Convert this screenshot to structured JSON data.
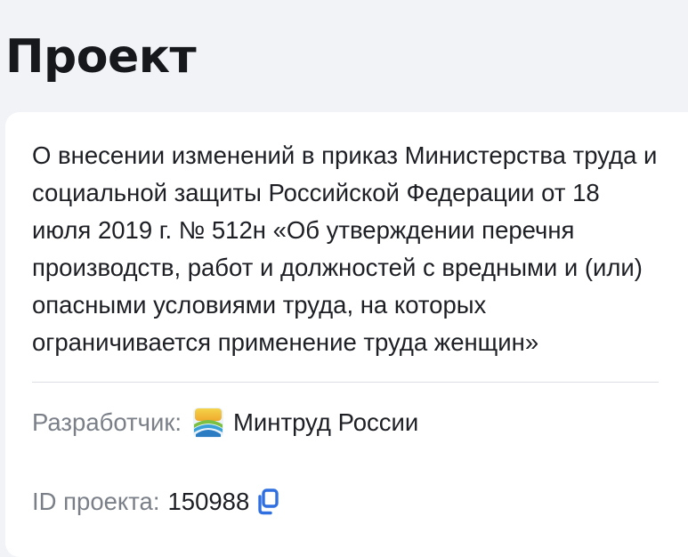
{
  "page": {
    "title": "Проект"
  },
  "project": {
    "description": "О внесении изменений в приказ Министерства труда и социальной защиты Российской Федерации от 18 июля 2019 г. № 512н «Об утверждении перечня производств, работ и должностей с вредными и (или) опасными условиями труда, на которых ограничивается применение труда женщин»",
    "developer_label": "Разработчик:",
    "developer_name": "Минтруд России",
    "developer_logo_icon": "mintrud-emblem-icon",
    "id_label": "ID проекта:",
    "id_value": "150988",
    "copy_icon": "copy-icon"
  },
  "colors": {
    "background": "#f1f3f6",
    "card": "#ffffff",
    "text_primary": "#1d1f24",
    "text_secondary": "#7a7f88",
    "accent": "#2f6fe0",
    "divider": "#dcdfe4"
  }
}
